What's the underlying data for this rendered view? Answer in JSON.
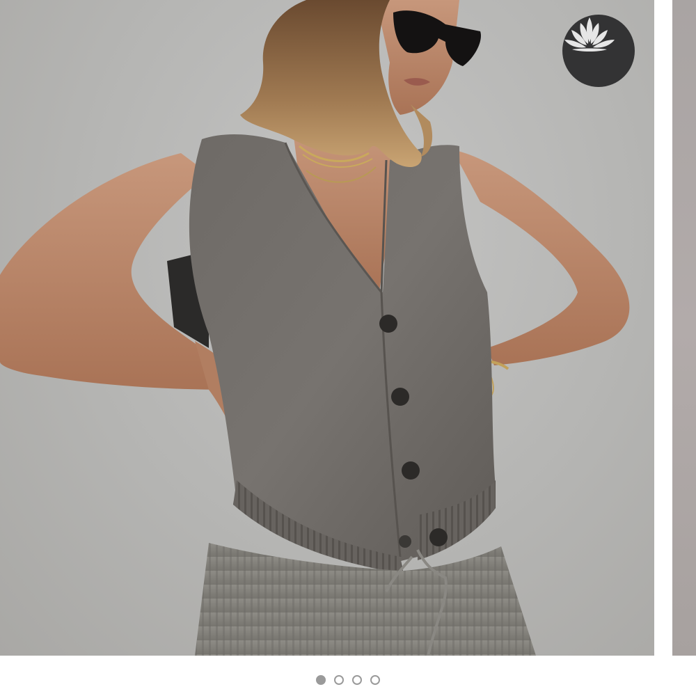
{
  "carousel": {
    "slide_count": 4,
    "active_index": 0,
    "main_image": {
      "subject": "model-in-grey-knit-vest",
      "background_color": "#b8b8b6"
    },
    "brand_badge": {
      "icon": "lotus-icon",
      "background_color": "#333334",
      "icon_color": "#e6e6e6"
    },
    "dots": [
      {
        "active": true
      },
      {
        "active": false
      },
      {
        "active": false
      },
      {
        "active": false
      }
    ],
    "dot_color": "#9a9a9a"
  }
}
